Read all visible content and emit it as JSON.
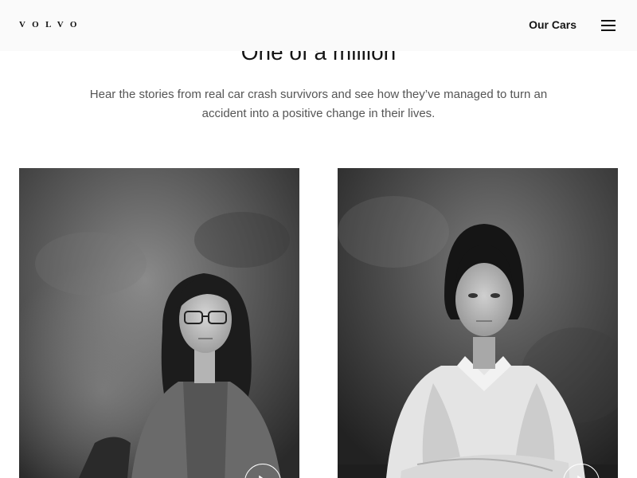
{
  "header": {
    "logo": "VOLVO",
    "nav_link": "Our Cars",
    "menu_icon": "hamburger-menu-icon"
  },
  "main": {
    "headline": "One of a million",
    "intro": "Hear the stories from real car crash survivors and see how they’ve managed to turn an accident into a positive change in their lives.",
    "cards": [
      {
        "photo": "portrait-woman-glasses-seated",
        "play_icon": "play-icon"
      },
      {
        "photo": "portrait-woman-white-shirt-arms-crossed",
        "play_icon": "play-icon"
      }
    ]
  },
  "colors": {
    "header_bg": "#fafafa",
    "text_primary": "#141414",
    "text_secondary": "#555555",
    "page_bg": "#ffffff"
  }
}
